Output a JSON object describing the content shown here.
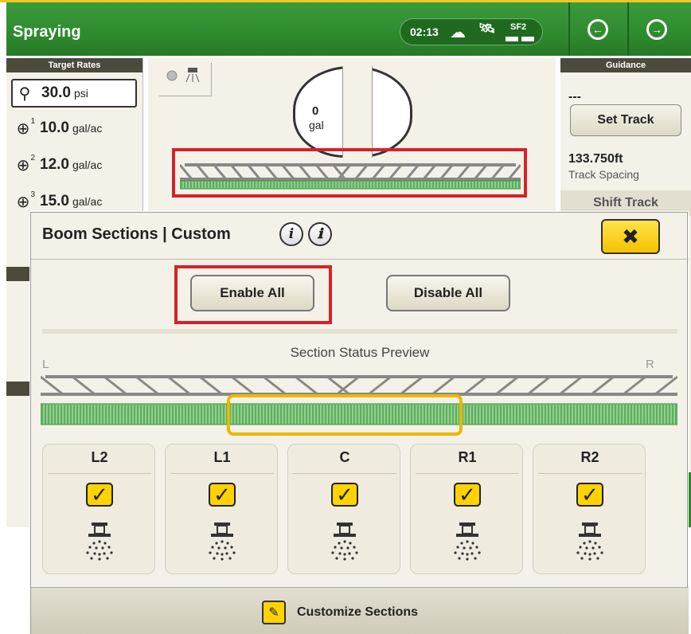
{
  "app": {
    "title": "Spraying",
    "time": "02:13",
    "sf_label": "SF2",
    "icons": {
      "cloud": "cloud-icon",
      "satellite": "satellite-icon",
      "back": "arrow-left-icon",
      "forward": "arrow-right-icon"
    }
  },
  "target_rates": {
    "header": "Target Rates",
    "rows": [
      {
        "value": "30.0",
        "unit": "psi",
        "icon": "pressure-gauge-icon",
        "index": ""
      },
      {
        "value": "10.0",
        "unit": "gal/ac",
        "icon": "crosshair-icon",
        "index": "1"
      },
      {
        "value": "12.0",
        "unit": "gal/ac",
        "icon": "crosshair-icon",
        "index": "2"
      },
      {
        "value": "15.0",
        "unit": "gal/ac",
        "icon": "crosshair-icon",
        "index": "3"
      }
    ]
  },
  "tank": {
    "value": "0",
    "unit": "gal"
  },
  "guidance": {
    "header": "Guidance",
    "line_value": "---",
    "set_track_label": "Set Track",
    "track_spacing_value": "133.750ft",
    "track_spacing_label": "Track Spacing",
    "shift_track_label": "Shift Track"
  },
  "modal": {
    "title": "Boom Sections | Custom",
    "enable_all_label": "Enable All",
    "disable_all_label": "Disable All",
    "preview_label": "Section Status Preview",
    "left_marker": "L",
    "right_marker": "R",
    "sections": [
      {
        "label": "L2",
        "checked": true
      },
      {
        "label": "L1",
        "checked": true
      },
      {
        "label": "C",
        "checked": true
      },
      {
        "label": "R1",
        "checked": true
      },
      {
        "label": "R2",
        "checked": true
      }
    ],
    "customize_label": "Customize Sections",
    "colors": {
      "accent_yellow": "#ffd200",
      "highlight_red": "#d8212a",
      "brand_green": "#2f8a2f"
    }
  }
}
